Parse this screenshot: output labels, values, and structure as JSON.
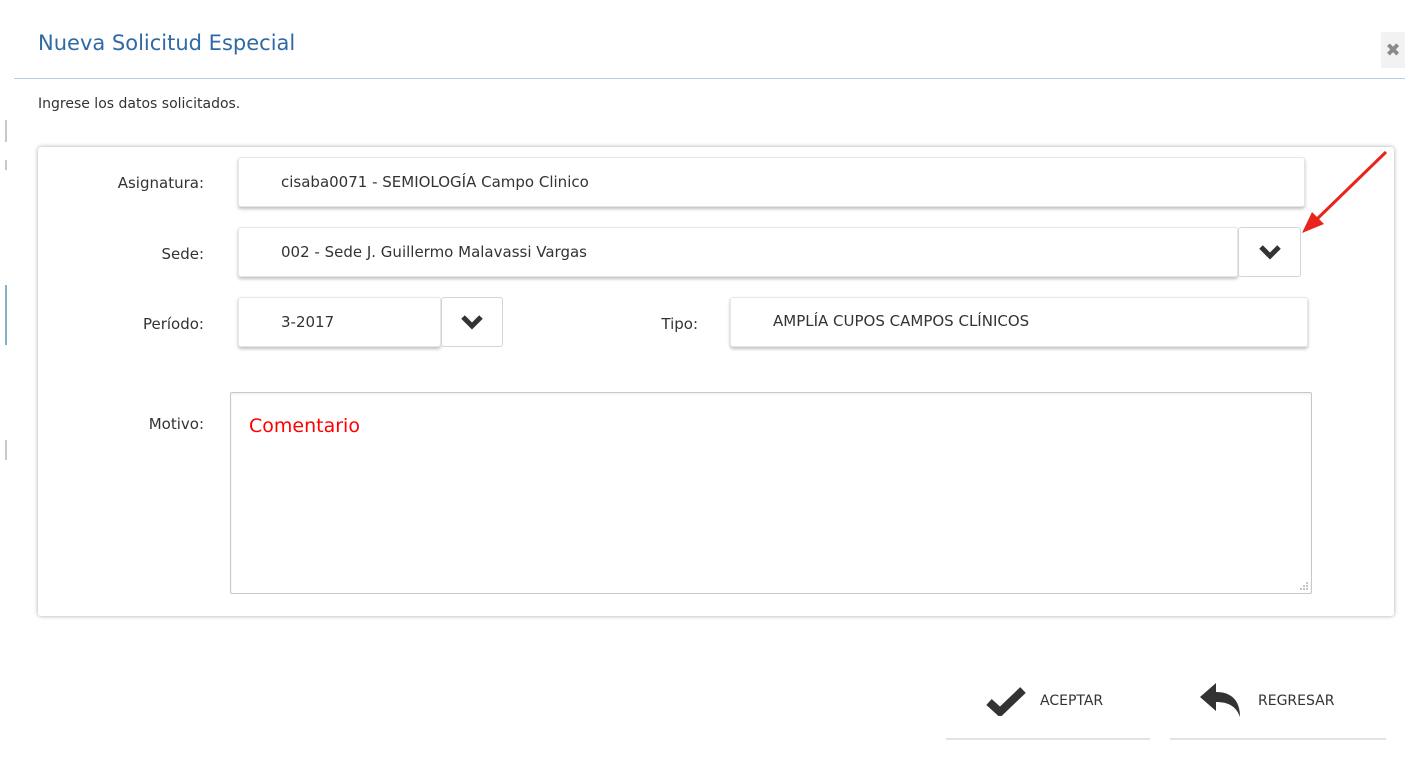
{
  "dialog": {
    "title": "Nueva Solicitud Especial",
    "close_icon": "close-icon",
    "instructions": "Ingrese los datos solicitados."
  },
  "form": {
    "asignatura": {
      "label": "Asignatura:",
      "value": "cisaba0071 - SEMIOLOGÍA Campo Clinico"
    },
    "sede": {
      "label": "Sede:",
      "value": "002 - Sede J. Guillermo Malavassi Vargas"
    },
    "periodo": {
      "label": "Período:",
      "value": "3-2017"
    },
    "tipo": {
      "label": "Tipo:",
      "value": "AMPLÍA CUPOS CAMPOS CLÍNICOS"
    },
    "motivo": {
      "label": "Motivo:",
      "value": "Comentario"
    }
  },
  "actions": {
    "accept_label": "ACEPTAR",
    "back_label": "REGRESAR"
  },
  "colors": {
    "title": "#2f6aa7",
    "annotation_arrow": "#e8241c",
    "motivo_text": "#ff0000"
  }
}
